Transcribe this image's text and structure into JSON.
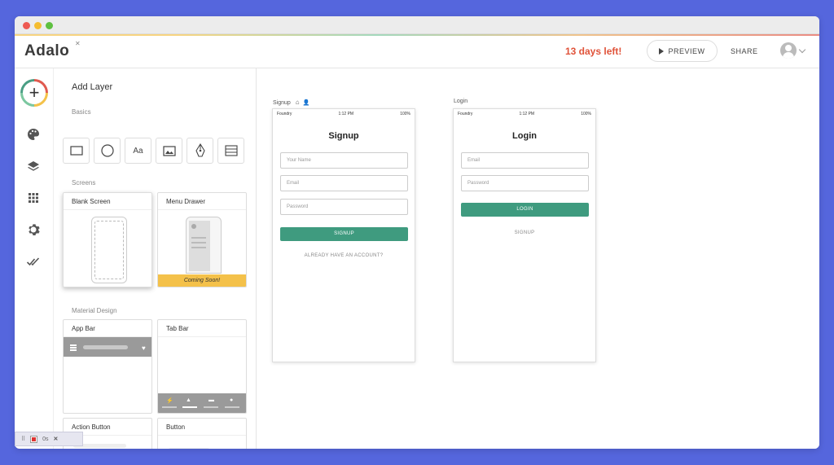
{
  "colors": {
    "background": "#5566dd",
    "accent_green": "#3f9b7f",
    "trial_red": "#e0533a",
    "coming_soon_yellow": "#f4c14a"
  },
  "header": {
    "logo_text": "Adalo",
    "trial_text": "13 days left!",
    "preview_label": "PREVIEW",
    "share_label": "SHARE",
    "avatar_icon": "user-avatar-icon"
  },
  "leftnav": {
    "items": [
      "add-icon",
      "palette-icon",
      "layers-icon",
      "grid-icon",
      "gear-icon",
      "check-all-icon"
    ]
  },
  "panel": {
    "title": "Add Layer",
    "basics_label": "Basics",
    "basics_items": [
      "rectangle-icon",
      "ellipse-icon",
      "text-icon",
      "image-icon",
      "pen-icon",
      "list-icon"
    ],
    "text_tool_label": "Aa",
    "screens_label": "Screens",
    "screens": [
      {
        "title": "Blank Screen"
      },
      {
        "title": "Menu Drawer",
        "badge": "Coming Soon!"
      }
    ],
    "material_label": "Material Design",
    "material": [
      {
        "title": "App Bar"
      },
      {
        "title": "Tab Bar"
      },
      {
        "title": "Action Button"
      },
      {
        "title": "Button"
      }
    ]
  },
  "canvas": {
    "signup": {
      "label": "Signup",
      "status_carrier": "Foundry",
      "status_time": "1:12 PM",
      "status_battery": "100%",
      "title": "Signup",
      "fields": [
        "Your Name",
        "Email",
        "Password"
      ],
      "button": "SIGNUP",
      "link": "ALREADY HAVE AN ACCOUNT?"
    },
    "login": {
      "label": "Login",
      "status_carrier": "Foundry",
      "status_time": "1:12 PM",
      "status_battery": "100%",
      "title": "Login",
      "fields": [
        "Email",
        "Password"
      ],
      "button": "LOGIN",
      "link": "SIGNUP"
    }
  },
  "devtools": {
    "timer": "0s"
  }
}
